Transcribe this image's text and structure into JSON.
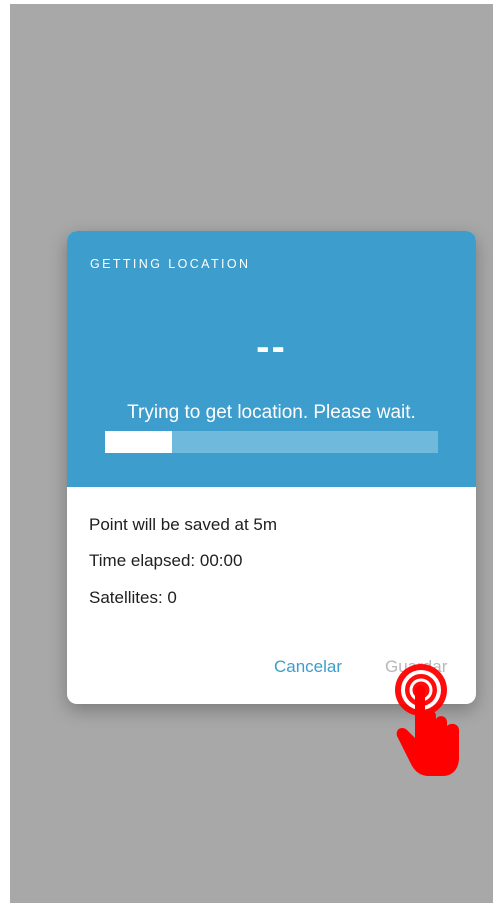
{
  "dialog": {
    "title": "GETTING LOCATION",
    "accuracy_value": "--",
    "status_message": "Trying to get location. Please wait.",
    "progress_fraction": 0.2,
    "info": {
      "save_threshold": "Point will be saved at 5m",
      "time_elapsed": "Time elapsed: 00:00",
      "satellites": "Satellites: 0"
    },
    "buttons": {
      "cancel_label": "Cancelar",
      "save_label": "Guardar"
    }
  },
  "colors": {
    "header_background": "#3d9dcc",
    "progress_track": "#6fb9dd",
    "cancel_text": "#3d9dcc",
    "save_text_disabled": "#b8b8b8",
    "overlay": "#a8a8a8",
    "tap_indicator": "#ff0000"
  },
  "icons": {
    "tap_indicator": "hand-pointer-tap-icon"
  }
}
